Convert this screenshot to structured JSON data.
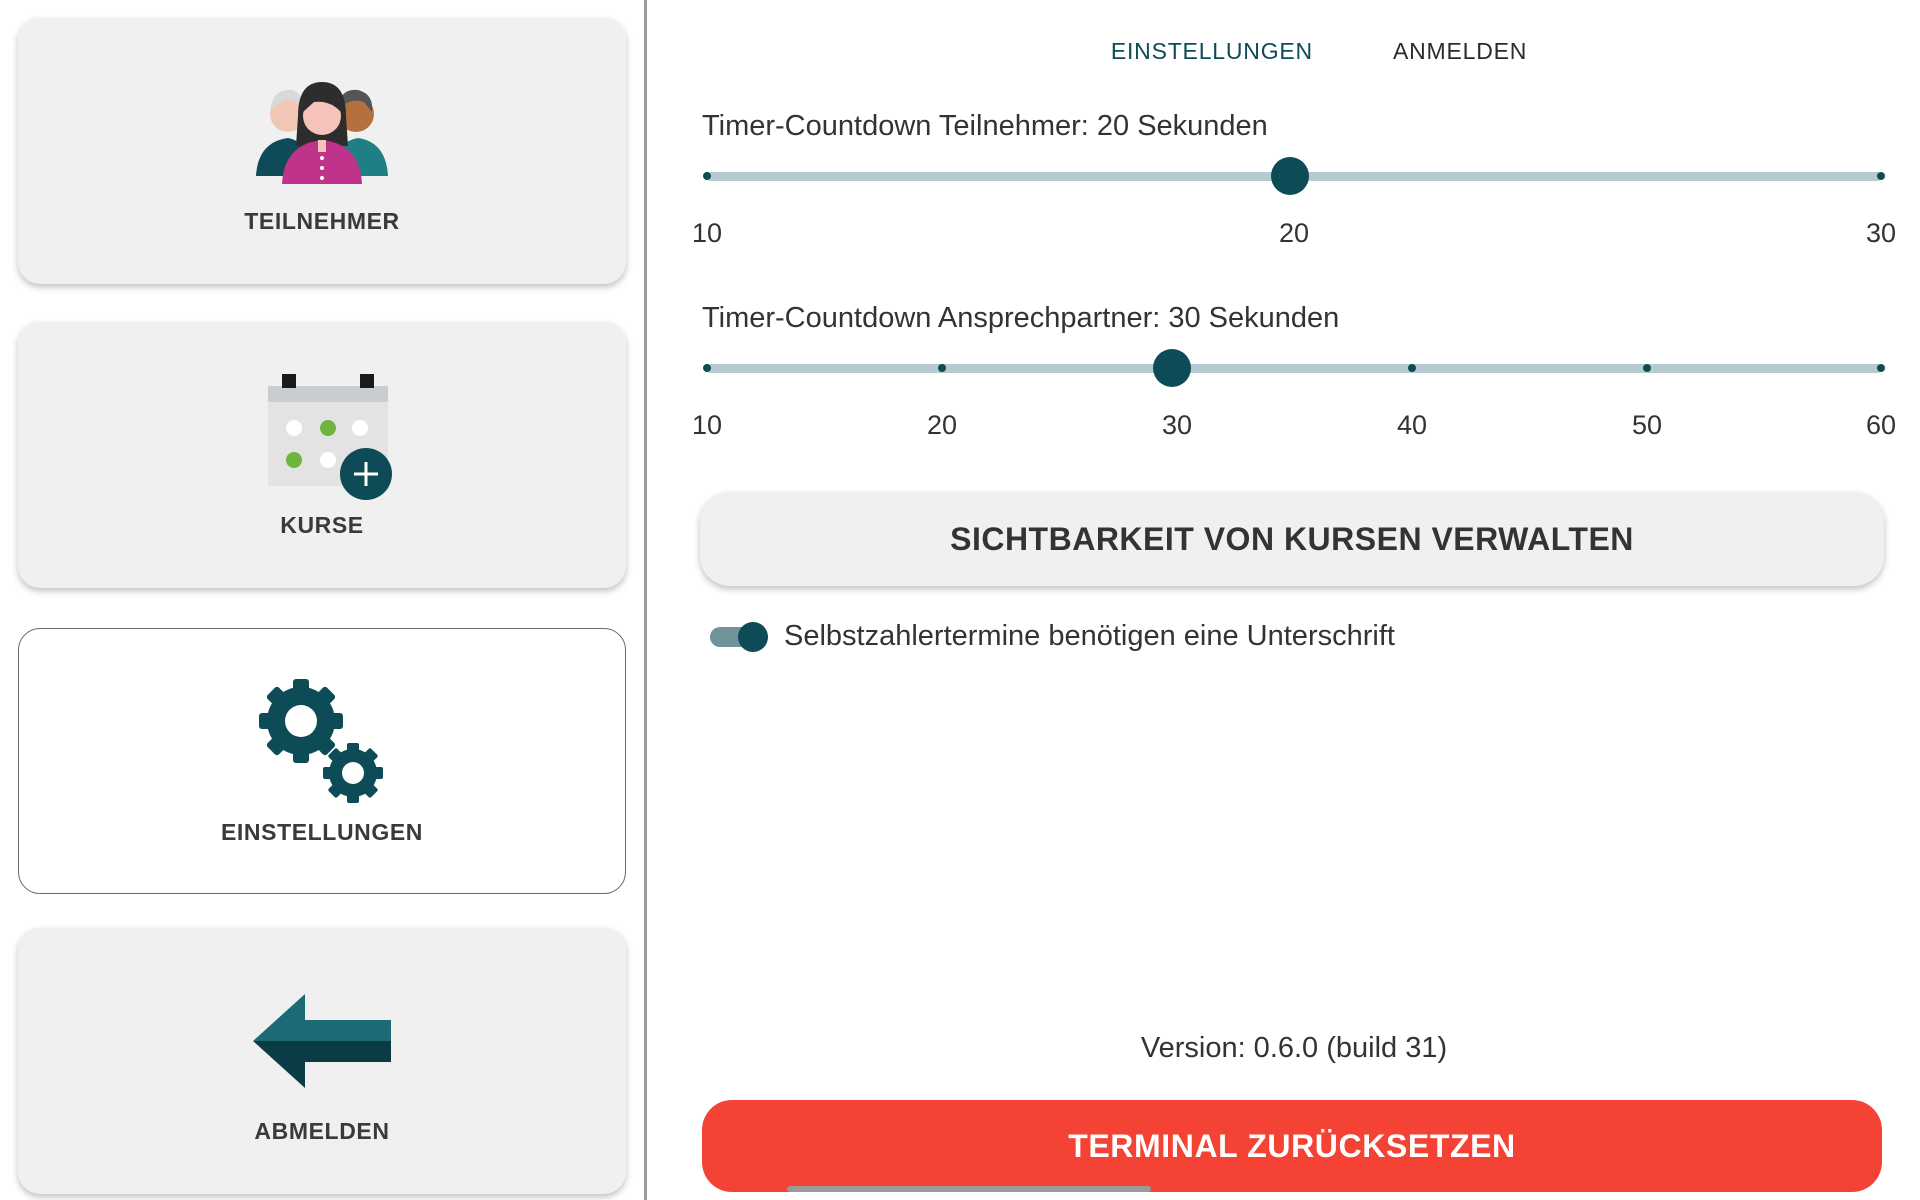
{
  "sidebar": {
    "items": [
      {
        "label": "TEILNEHMER",
        "icon": "participants-icon",
        "active": false
      },
      {
        "label": "KURSE",
        "icon": "calendar-add-icon",
        "active": false
      },
      {
        "label": "EINSTELLUNGEN",
        "icon": "gears-icon",
        "active": true
      },
      {
        "label": "ABMELDEN",
        "icon": "arrow-left-icon",
        "active": false
      }
    ]
  },
  "tabs": [
    {
      "label": "EINSTELLUNGEN",
      "active": true
    },
    {
      "label": "ANMELDEN",
      "active": false
    }
  ],
  "settings": {
    "participant_timer": {
      "title": "Timer-Countdown Teilnehmer: 20 Sekunden",
      "min": 10,
      "max": 30,
      "value": 20,
      "tick_labels": [
        "10",
        "20",
        "30"
      ]
    },
    "contact_timer": {
      "title": "Timer-Countdown Ansprechpartner: 30 Sekunden",
      "min": 10,
      "max": 60,
      "value": 30,
      "tick_labels": [
        "10",
        "20",
        "30",
        "40",
        "50",
        "60"
      ]
    },
    "manage_visibility_label": "SICHTBARKEIT VON KURSEN VERWALTEN",
    "signature_toggle": {
      "label": "Selbstzahlertermine benötigen eine Unterschrift",
      "checked": true
    }
  },
  "footer": {
    "version": "Version: 0.6.0 (build 31)",
    "reset_label": "TERMINAL ZURÜCKSETZEN"
  },
  "colors": {
    "accent": "#0d4b57",
    "danger": "#f44235",
    "track": "#b5cbcf"
  }
}
